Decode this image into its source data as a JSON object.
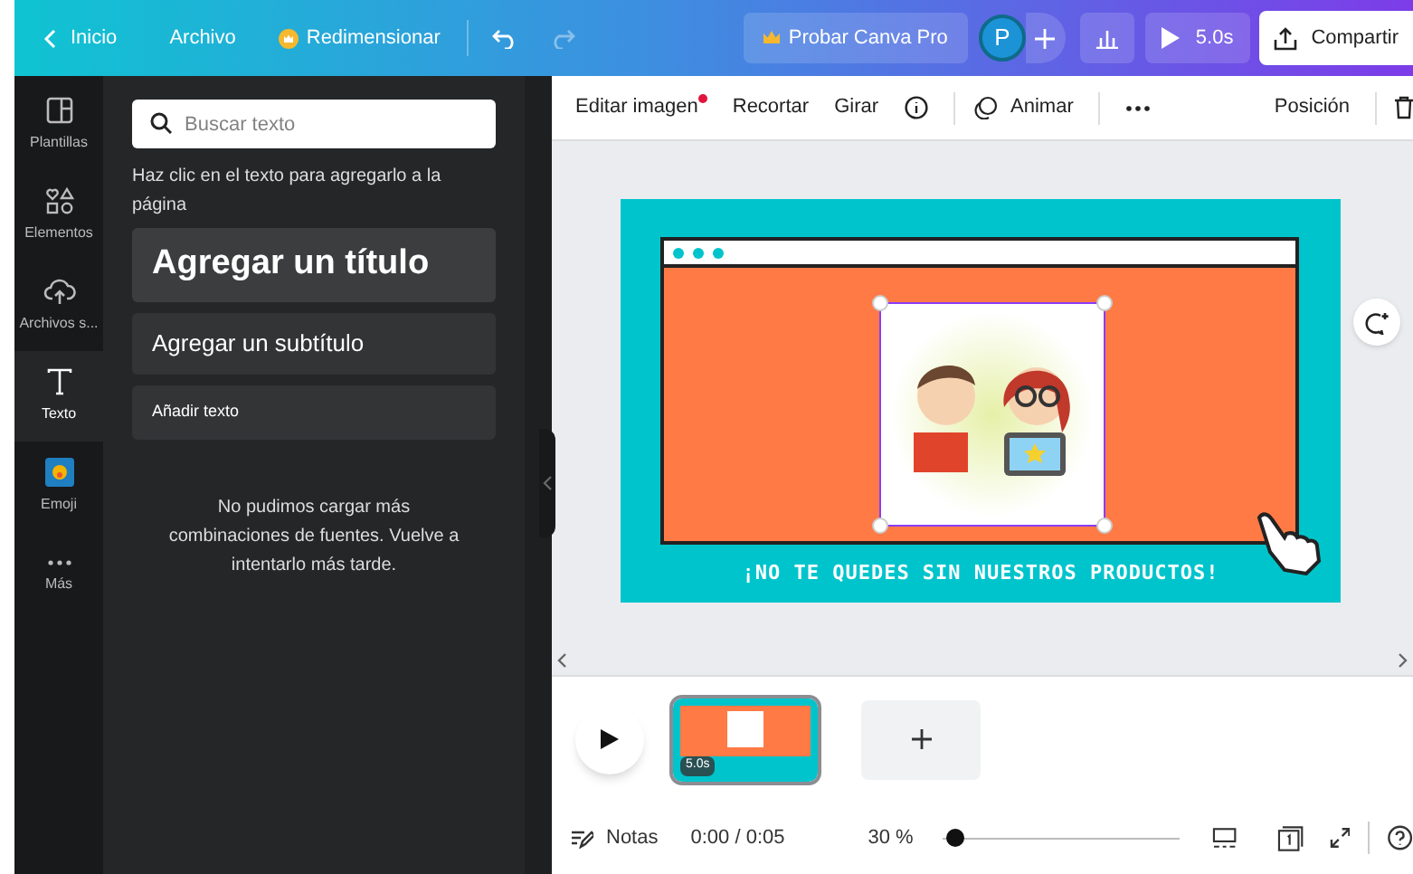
{
  "top_bar": {
    "back": "Inicio",
    "file": "Archivo",
    "resize": "Redimensionar",
    "pro": "Probar Canva Pro",
    "avatar": "P",
    "duration": "5.0s",
    "share": "Compartir"
  },
  "side_rail": [
    {
      "kind": "templates",
      "label": "Plantillas",
      "selected": false
    },
    {
      "kind": "elements",
      "label": "Elementos",
      "selected": false
    },
    {
      "kind": "uploads",
      "label": "Archivos s...",
      "selected": false
    },
    {
      "kind": "text",
      "label": "Texto",
      "selected": true
    },
    {
      "kind": "emoji",
      "label": "Emoji",
      "selected": false
    },
    {
      "kind": "more",
      "label": "Más",
      "selected": false
    }
  ],
  "panel": {
    "search": {
      "placeholder": "Buscar texto"
    },
    "hint": "Haz clic en el texto para agregarlo a la página",
    "presets": [
      {
        "kind": "heading",
        "label": "Agregar un título"
      },
      {
        "kind": "subheading",
        "label": "Agregar un subtítulo"
      },
      {
        "kind": "body",
        "label": "Añadir texto"
      }
    ],
    "error": "No pudimos cargar más combinaciones de fuentes. Vuelve a intentarlo más tarde."
  },
  "toolbar": {
    "items": [
      "Editar imagen",
      "Recortar",
      "Girar"
    ],
    "animate": "Animar",
    "position": "Posición"
  },
  "design": {
    "caption": "¡NO TE QUEDES SIN NUESTROS PRODUCTOS!"
  },
  "timeline": {
    "pages": [
      {
        "duration": "5.0s",
        "selected": true
      }
    ]
  },
  "footer": {
    "notes": "Notas",
    "time": "0:00 / 0:05",
    "zoom": "30 %",
    "zoom_level": {
      "level": 0.02
    }
  }
}
